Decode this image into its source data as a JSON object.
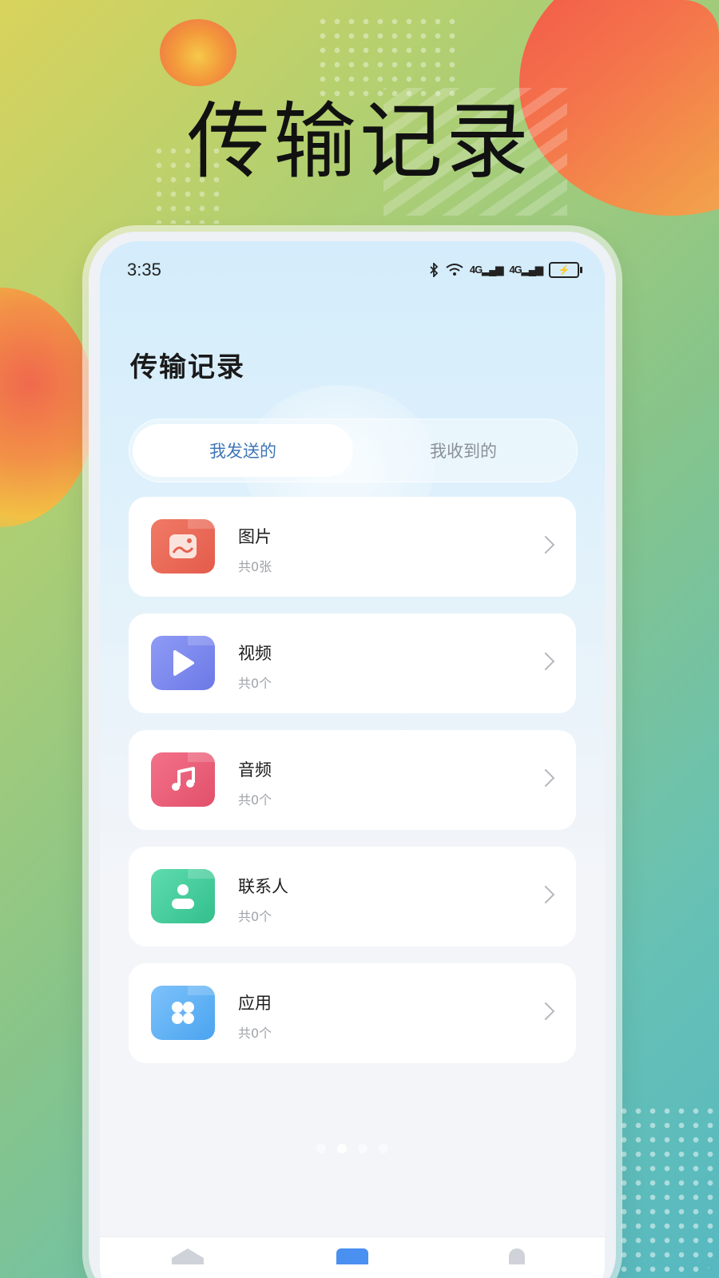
{
  "promo": {
    "title": "传输记录"
  },
  "status_bar": {
    "time": "3:35",
    "signal_1": "4G",
    "signal_2": "4G",
    "icons": [
      "bluetooth-icon",
      "wifi-icon",
      "signal-icon",
      "signal-icon",
      "battery-charging-icon"
    ]
  },
  "page": {
    "title": "传输记录"
  },
  "tabs": [
    {
      "label": "我发送的",
      "active": true
    },
    {
      "label": "我收到的",
      "active": false
    }
  ],
  "categories": [
    {
      "title": "图片",
      "count": "共0张",
      "icon": "image-icon",
      "color": "#e8604f"
    },
    {
      "title": "视频",
      "count": "共0个",
      "icon": "play-icon",
      "color": "#7482ea"
    },
    {
      "title": "音频",
      "count": "共0个",
      "icon": "music-note-icon",
      "color": "#e65872"
    },
    {
      "title": "联系人",
      "count": "共0个",
      "icon": "contact-icon",
      "color": "#3ec997"
    },
    {
      "title": "应用",
      "count": "共0个",
      "icon": "apps-icon",
      "color": "#59aef3"
    }
  ],
  "pager": {
    "total": 4,
    "active_index": 1
  }
}
